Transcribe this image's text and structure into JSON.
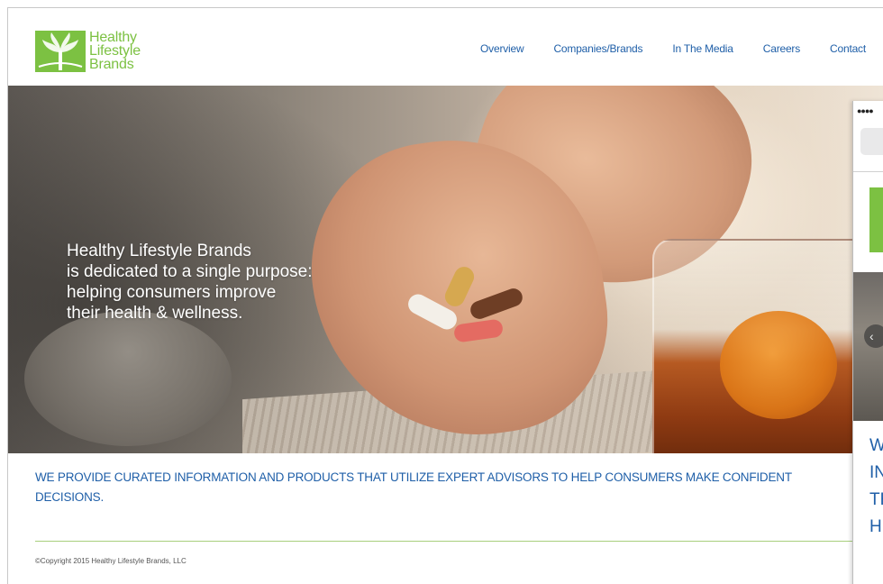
{
  "header": {
    "logo_lines": [
      "Healthy",
      "Lifestyle",
      "Brands"
    ],
    "nav": [
      "Overview",
      "Companies/Brands",
      "In The Media",
      "Careers",
      "Contact"
    ]
  },
  "hero": {
    "lines": [
      "Healthy Lifestyle Brands",
      "is dedicated to a single purpose:",
      "helping consumers improve",
      "their health & wellness."
    ]
  },
  "tagline": "WE PROVIDE CURATED INFORMATION AND PRODUCTS THAT UTILIZE EXPERT ADVISORS TO HELP CONSUMERS MAKE CONFIDENT DECISIONS.",
  "footer": {
    "copyright": "©Copyright 2015 Healthy Lifestyle Brands, LLC"
  },
  "mobile_preview": {
    "status": "●●●●",
    "text_lines": [
      "W",
      "IN",
      "TH",
      "H"
    ],
    "carousel_icon": "chevron-left-icon"
  },
  "colors": {
    "brand_green": "#7cc142",
    "link_blue": "#1f5fa8",
    "divider_green": "#a8cf7c"
  }
}
